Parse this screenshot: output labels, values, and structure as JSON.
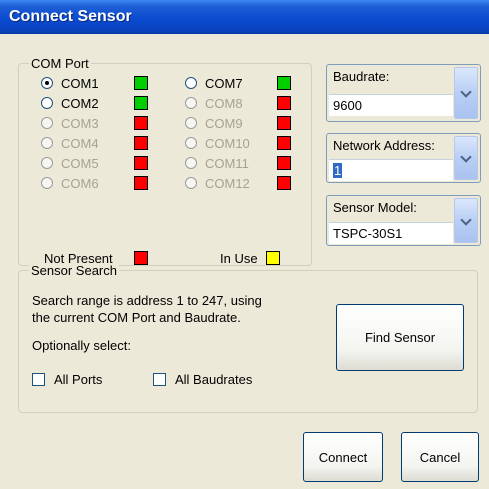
{
  "window": {
    "title": "Connect Sensor"
  },
  "com_port": {
    "legend": "COM Port",
    "ports": [
      {
        "label": "COM1",
        "selected": true,
        "enabled": true,
        "status": "green"
      },
      {
        "label": "COM2",
        "selected": false,
        "enabled": true,
        "status": "green"
      },
      {
        "label": "COM3",
        "selected": false,
        "enabled": false,
        "status": "red"
      },
      {
        "label": "COM4",
        "selected": false,
        "enabled": false,
        "status": "red"
      },
      {
        "label": "COM5",
        "selected": false,
        "enabled": false,
        "status": "red"
      },
      {
        "label": "COM6",
        "selected": false,
        "enabled": false,
        "status": "red"
      },
      {
        "label": "COM7",
        "selected": false,
        "enabled": true,
        "status": "green"
      },
      {
        "label": "COM8",
        "selected": false,
        "enabled": false,
        "status": "red"
      },
      {
        "label": "COM9",
        "selected": false,
        "enabled": false,
        "status": "red"
      },
      {
        "label": "COM10",
        "selected": false,
        "enabled": false,
        "status": "red"
      },
      {
        "label": "COM11",
        "selected": false,
        "enabled": false,
        "status": "red"
      },
      {
        "label": "COM12",
        "selected": false,
        "enabled": false,
        "status": "red"
      }
    ],
    "legend_not_present": "Not Present",
    "legend_in_use": "In Use"
  },
  "baudrate": {
    "label": "Baudrate:",
    "value": "9600"
  },
  "network_address": {
    "label": "Network Address:",
    "value": "1"
  },
  "sensor_model": {
    "label": "Sensor Model:",
    "value": "TSPC-30S1"
  },
  "sensor_search": {
    "legend": "Sensor Search",
    "description_line1": "Search range is address 1 to 247, using",
    "description_line2": "the current COM Port and Baudrate.",
    "optional_label": "Optionally select:",
    "all_ports_label": "All Ports",
    "all_baudrates_label": "All Baudrates",
    "find_button": "Find Sensor"
  },
  "footer": {
    "connect_label": "Connect",
    "cancel_label": "Cancel"
  },
  "colors": {
    "green": "#00d000",
    "red": "#ff0000",
    "yellow": "#ffff00",
    "title_blue": "#0a4bd0"
  }
}
